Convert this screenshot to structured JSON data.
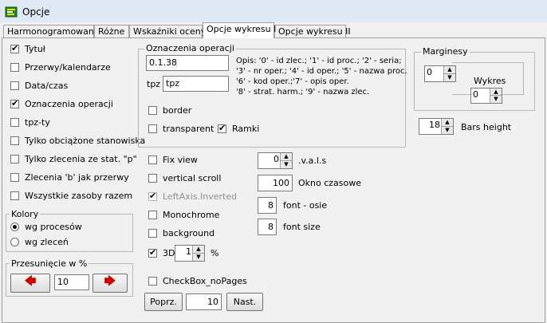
{
  "window": {
    "title": "Opcje"
  },
  "tabs": [
    {
      "label": "Harmonogramowanie"
    },
    {
      "label": "Różne"
    },
    {
      "label": "Wskaźniki oceny"
    },
    {
      "label": "Opcje wykresu I"
    },
    {
      "label": "Opcje wykresu II"
    }
  ],
  "left_checks": [
    {
      "label": "Tytuł",
      "checked": true
    },
    {
      "label": "Przerwy/kalendarze",
      "checked": false
    },
    {
      "label": "Data/czas",
      "checked": false
    },
    {
      "label": "Oznaczenia operacji",
      "checked": true
    },
    {
      "label": "tpz-ty",
      "checked": false
    },
    {
      "label": "Tylko obciążone stanowiska",
      "checked": false
    },
    {
      "label": "Tylko zlecenia ze stat. \"p\"",
      "checked": false
    },
    {
      "label": "Zlecenia 'b' jak przerwy",
      "checked": false
    },
    {
      "label": "Wszystkie zasoby razem",
      "checked": false
    }
  ],
  "kolory": {
    "title": "Kolory",
    "options": [
      {
        "label": "wg procesów",
        "selected": true
      },
      {
        "label": "wg zleceń",
        "selected": false
      }
    ]
  },
  "przesuniecie": {
    "title": "Przesunięcie w %",
    "value": "10"
  },
  "oznaczenia": {
    "title": "Oznaczenia operacji",
    "value": "0.1.38",
    "tpz_label": "tpz",
    "tpz_value": "tpz",
    "opis_lines": [
      "Opis: '0' - id zlec.; '1' - id proc.; '2' - seria;",
      "'3' - nr oper.; '4' - id oper.; '5' - nazwa proc.",
      "'6' - kod oper.;'7' - opis oper.",
      "'8' - strat. harm.; '9' - nazwa zlec."
    ],
    "border": {
      "label": "border",
      "checked": false
    },
    "transparent": {
      "label": "transparent",
      "checked": false
    },
    "ramki": {
      "label": "Ramki",
      "checked": true
    }
  },
  "mid_checks": [
    {
      "label": "Fix view",
      "checked": false,
      "disabled": false
    },
    {
      "label": "vertical scroll",
      "checked": false,
      "disabled": false
    },
    {
      "label": "LeftAxis.Inverted",
      "checked": true,
      "disabled": true
    },
    {
      "label": "Monochrome",
      "checked": false,
      "disabled": false
    },
    {
      "label": "background",
      "checked": false,
      "disabled": false
    },
    {
      "label": "3D",
      "checked": true,
      "disabled": false
    }
  ],
  "three_d": {
    "value": "1",
    "unit": "%"
  },
  "checkbox_nopages": {
    "label": "CheckBox_noPages",
    "checked": false
  },
  "paging": {
    "prev": "Poprz.",
    "value": "10",
    "next": "Nast."
  },
  "numeric": {
    "vals": {
      "value": "0",
      "label": ".v.a.l.s"
    },
    "okno": {
      "value": "100",
      "label": "Okno czasowe"
    },
    "font_osie": {
      "value": "8",
      "label": "font - osie"
    },
    "font_size": {
      "value": "8",
      "label": "font size"
    }
  },
  "marginesy": {
    "title": "Marginesy",
    "value": "0",
    "wykres_label": "Wykres",
    "wykres_value": "0"
  },
  "bars_height": {
    "value": "18",
    "label": "Bars height"
  }
}
